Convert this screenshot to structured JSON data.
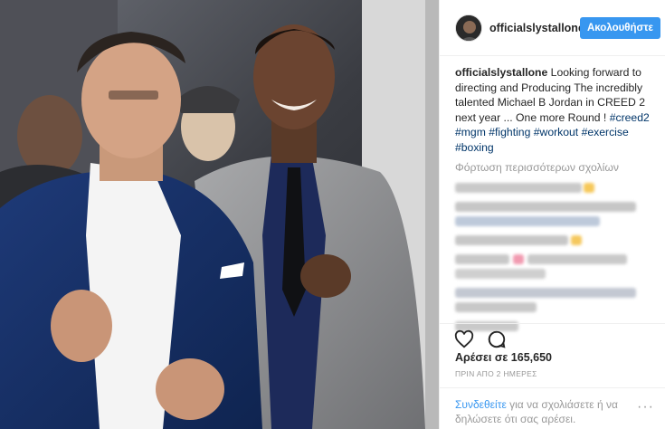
{
  "post": {
    "username": "officialslystallone",
    "follow_label": "Ακολουθήστε",
    "caption": {
      "user": "officialslystallone",
      "text": " Looking forward to directing and Producing The incredibly talented Michael B Jordan in CREED 2 next year ... One more Round ! ",
      "hashtags": [
        "#creed2",
        "#mgm",
        "#fighting",
        "#workout",
        "#exercise",
        "#boxing"
      ]
    },
    "load_more_label": "Φόρτωση περισσότερων σχολίων",
    "likes_label": "Αρέσει σε 165,650",
    "timestamp": "ΠΡΙΝ ΑΠΟ 2 ΗΜΕΡΕΣ",
    "login_link": "Συνδεθείτε",
    "login_rest": " για να σχολιάσετε ή να δηλώσετε ότι σας αρέσει.",
    "more_label": "···"
  },
  "icons": {
    "like": "heart-icon",
    "comment": "comment-bubble-icon",
    "more": "more-options-icon"
  },
  "colors": {
    "follow_button": "#3897f0",
    "hashtag": "#003569",
    "muted_text": "#999999",
    "login_link": "#3897f0"
  }
}
